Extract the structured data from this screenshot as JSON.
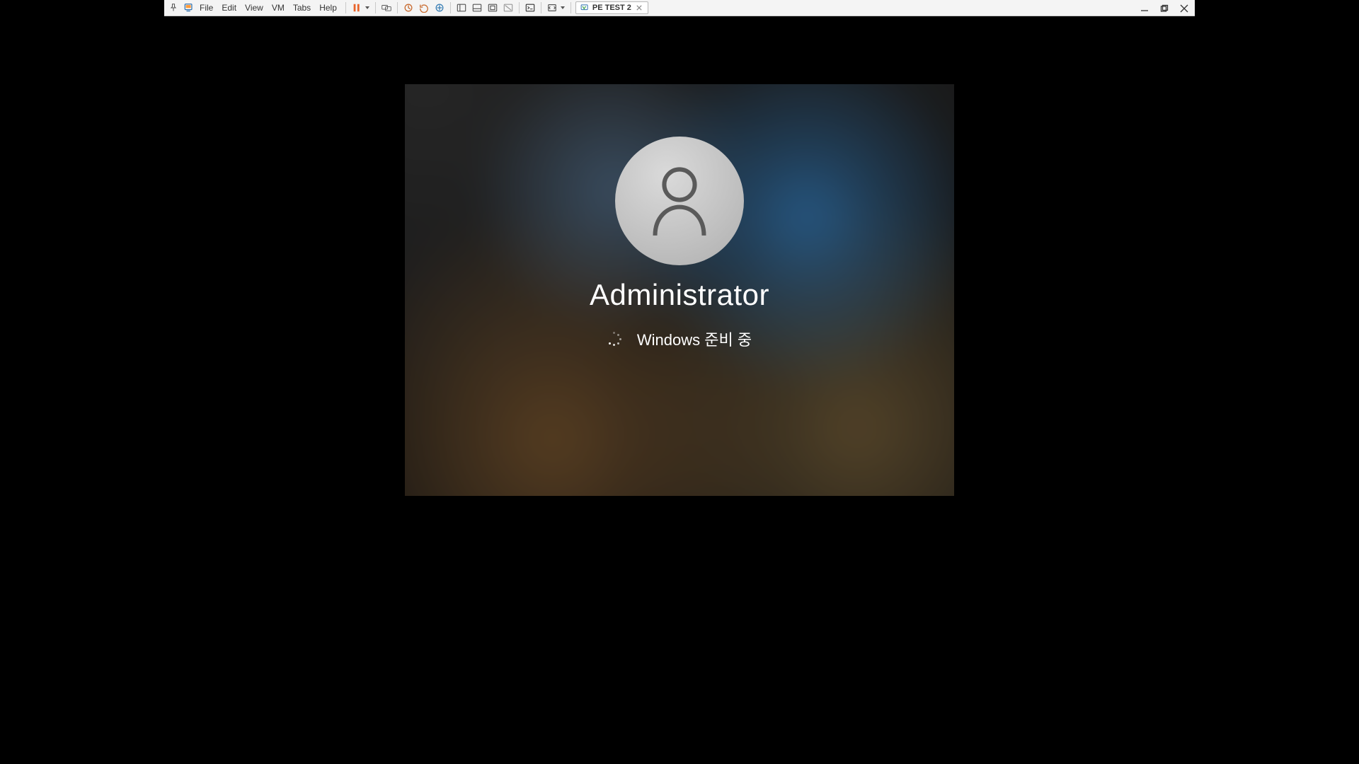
{
  "menu": {
    "file": "File",
    "edit": "Edit",
    "view": "View",
    "vm": "VM",
    "tabs": "Tabs",
    "help": "Help"
  },
  "tab": {
    "label": "PE TEST 2"
  },
  "login": {
    "username": "Administrator",
    "status": "Windows 준비 중"
  }
}
